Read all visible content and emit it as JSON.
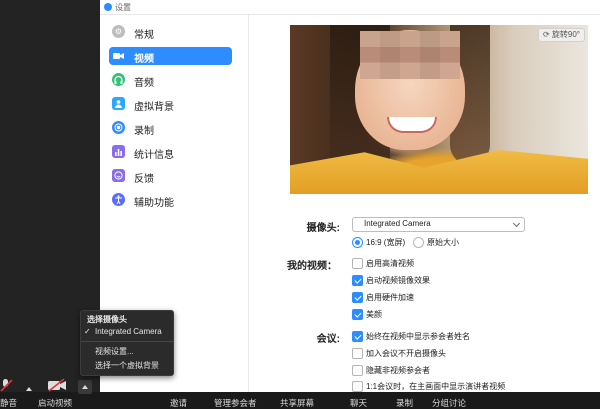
{
  "window": {
    "title": "设置"
  },
  "sidebar": {
    "items": [
      {
        "label": "常规",
        "icon": "gear-icon",
        "color": "#bdbdbd",
        "active": false
      },
      {
        "label": "视频",
        "icon": "video-camera-icon",
        "color": "#2d8cff",
        "active": true
      },
      {
        "label": "音频",
        "icon": "headphones-icon",
        "color": "#35c07a",
        "active": false
      },
      {
        "label": "虚拟背景",
        "icon": "person-background-icon",
        "color": "#2da6ff",
        "active": false
      },
      {
        "label": "录制",
        "icon": "record-icon",
        "color": "#2d8cff",
        "active": false
      },
      {
        "label": "统计信息",
        "icon": "bar-chart-icon",
        "color": "#8a6cf0",
        "active": false
      },
      {
        "label": "反馈",
        "icon": "smile-feedback-icon",
        "color": "#8a6cf0",
        "active": false
      },
      {
        "label": "辅助功能",
        "icon": "accessibility-icon",
        "color": "#5a6cff",
        "active": false
      }
    ]
  },
  "preview": {
    "rotate_label": "旋转90°"
  },
  "camera": {
    "label": "摄像头:",
    "selected": "Integrated Camera"
  },
  "aspect": {
    "options": [
      "16:9 (宽屏)",
      "原始大小"
    ],
    "selected_index": 0
  },
  "my_video": {
    "label": "我的视频：",
    "options": [
      {
        "label": "启用高清视频",
        "checked": false
      },
      {
        "label": "启动视频镜像效果",
        "checked": true
      },
      {
        "label": "启用硬件加速",
        "checked": true
      },
      {
        "label": "美颜",
        "checked": true
      }
    ]
  },
  "meeting": {
    "label": "会议:",
    "options": [
      {
        "label": "始终在视频中显示参会者姓名",
        "checked": true
      },
      {
        "label": "加入会议不开启摄像头",
        "checked": false
      },
      {
        "label": "隐藏非视频参会者",
        "checked": false
      },
      {
        "label": "1:1会议时，在主画面中显示演讲者视频",
        "checked": false
      }
    ]
  },
  "camera_menu": {
    "header": "选择摄像头",
    "camera_item": "Integrated Camera",
    "settings_item": "视频设置...",
    "virtual_bg_item": "选择一个虚拟背景"
  },
  "toolbar": {
    "mute_label": "静音",
    "video_label": "启动视频",
    "bottom_items": [
      "邀请",
      "管理参会者",
      "共享屏幕",
      "聊天",
      "录制",
      "分组讨论"
    ]
  },
  "colors": {
    "accent": "#2d8cff",
    "toolbar_bg": "#1a1a1a",
    "menu_bg": "#2b2b2b"
  }
}
